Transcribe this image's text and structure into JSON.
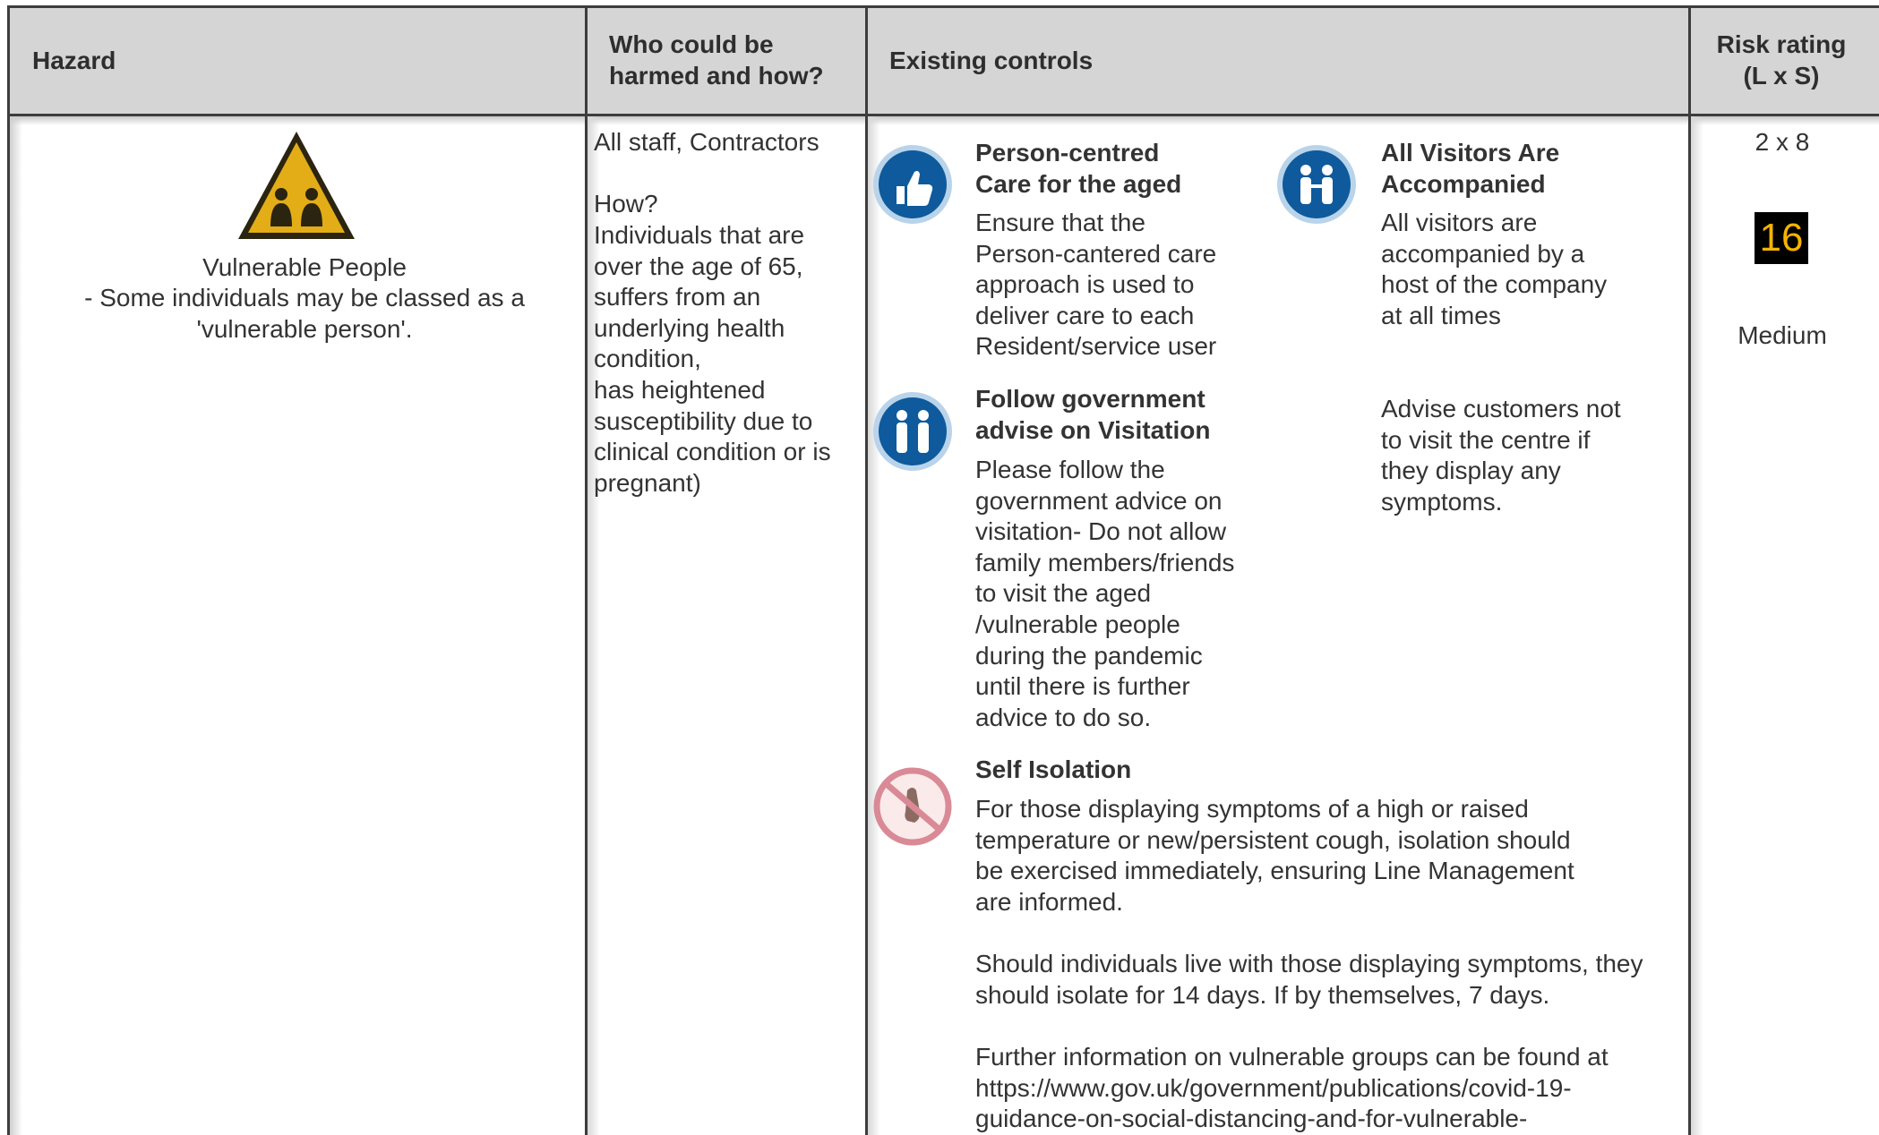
{
  "header": {
    "hazard": "Hazard",
    "who": "Who could be\nharmed and how?",
    "controls": "Existing controls",
    "risk": "Risk rating\n(L x S)"
  },
  "hazard": {
    "icon": "warning-people-icon",
    "title": "Vulnerable People",
    "description": "- Some individuals may be classed as a\n'vulnerable person'."
  },
  "who": {
    "groups": "All staff, Contractors",
    "how_label": "How?",
    "how_text": "Individuals that are\nover the age of 65,\nsuffers from an\nunderlying health\ncondition,\nhas heightened\nsusceptibility due to\nclinical condition or is\npregnant)"
  },
  "controls": {
    "person_centred": {
      "icon": "thumbs-up-icon",
      "title": "Person-centred\nCare for the aged",
      "body": "Ensure that the\nPerson-cantered care\napproach is used to\ndeliver care to each\nResident/service user"
    },
    "visitors": {
      "icon": "visitors-icon",
      "title": "All Visitors Are\nAccompanied",
      "body": "All visitors are\naccompanied by a\nhost of the company\nat all times",
      "extra": "Advise customers not\nto visit the centre if\nthey display any\nsymptoms."
    },
    "government": {
      "icon": "visitation-icon",
      "title": "Follow government\nadvise on Visitation",
      "body": "Please follow the\ngovernment advice on\nvisitation- Do not allow\nfamily members/friends\nto visit the aged\n/vulnerable people\nduring the pandemic\nuntil there is further\nadvice to do so."
    },
    "self_isolation": {
      "icon": "no-contact-icon",
      "title": "Self Isolation",
      "p1": "For those displaying symptoms of a high or raised\ntemperature or new/persistent cough, isolation should\nbe exercised immediately, ensuring Line Management\nare informed.",
      "p2": "Should individuals live with those displaying symptoms, they\nshould isolate for 14 days. If by themselves, 7 days.",
      "p3": "Further information on vulnerable groups can be found at\nhttps://www.gov.uk/government/publications/covid-19-\nguidance-on-social-distancing-and-for-vulnerable-"
    }
  },
  "risk": {
    "formula": "2 x 8",
    "score": "16",
    "level": "Medium",
    "score_bg": "#000000",
    "score_fg": "#f5b301"
  }
}
